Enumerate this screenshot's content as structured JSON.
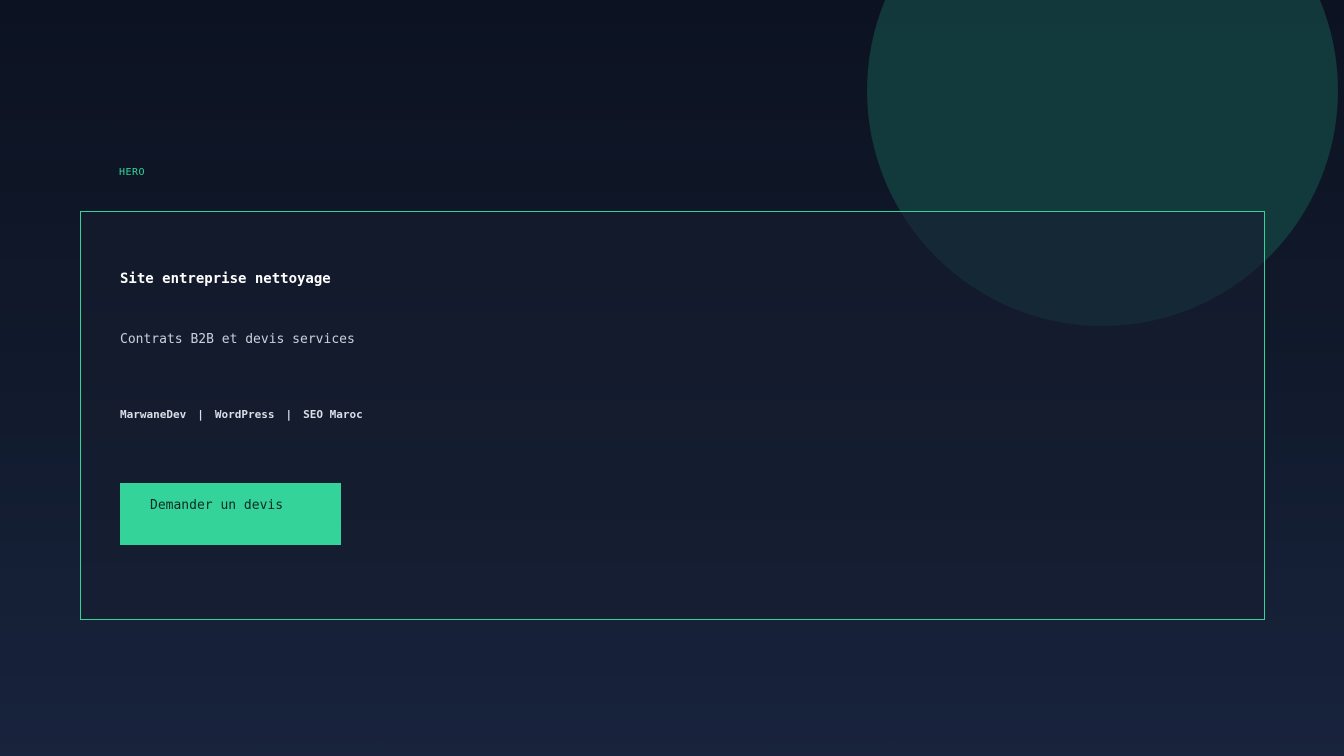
{
  "section": {
    "label": "HERO"
  },
  "hero": {
    "title": "Site entreprise nettoyage",
    "subtitle": "Contrats B2B et devis services",
    "meta": [
      "MarwaneDev",
      "WordPress",
      "SEO Maroc"
    ],
    "separator": "|",
    "cta_label": "Demander un devis"
  },
  "colors": {
    "accent": "#34d399",
    "background_top": "#0c1221",
    "background_bottom": "#18233d",
    "decor_circle": "#133b3d"
  }
}
